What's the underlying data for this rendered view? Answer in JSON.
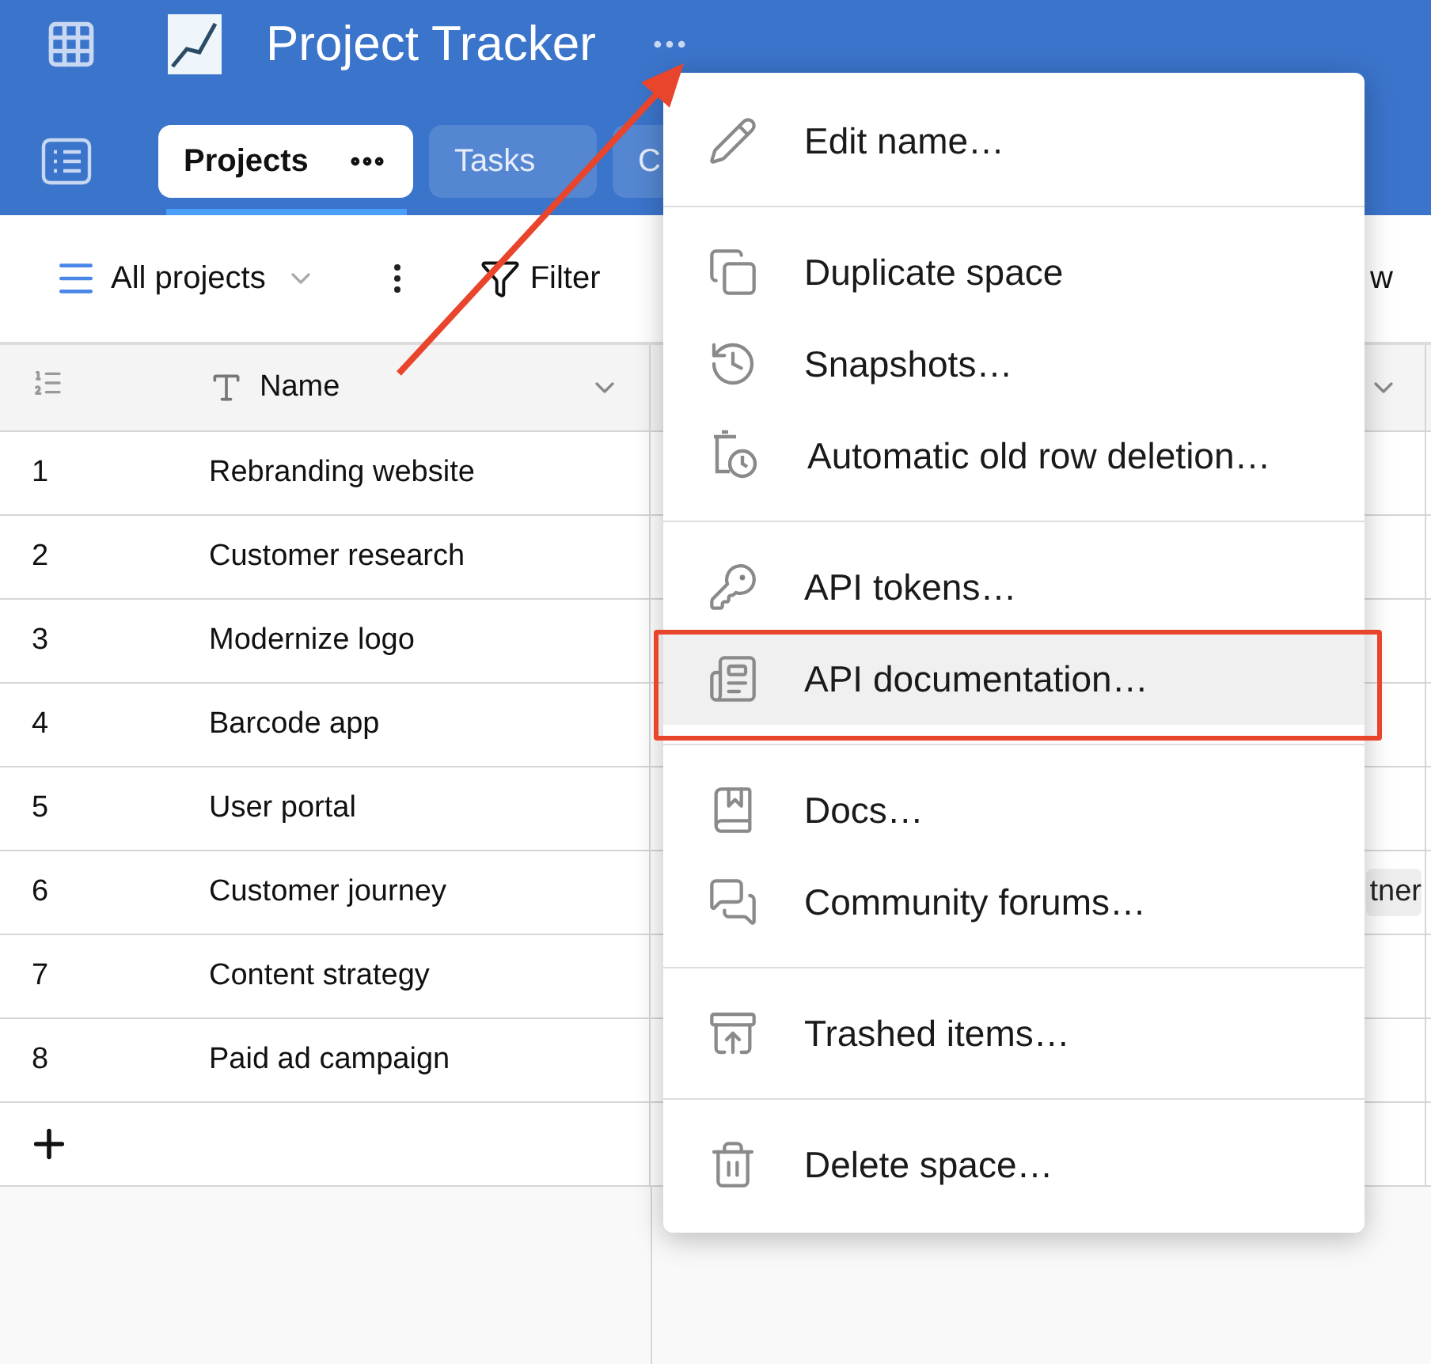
{
  "header": {
    "title": "Project Tracker"
  },
  "tabs": [
    {
      "label": "Projects",
      "selected": true
    },
    {
      "label": "Tasks",
      "selected": false
    },
    {
      "label": "C",
      "selected": false
    }
  ],
  "toolbar": {
    "view": "All projects",
    "filter": "Filter",
    "cut_text": "w"
  },
  "table": {
    "columns": [
      {
        "label": "Name"
      }
    ],
    "rows": [
      {
        "number": "1",
        "name": "Rebranding website"
      },
      {
        "number": "2",
        "name": "Customer research"
      },
      {
        "number": "3",
        "name": "Modernize logo"
      },
      {
        "number": "4",
        "name": "Barcode app"
      },
      {
        "number": "5",
        "name": "User portal"
      },
      {
        "number": "6",
        "name": "Customer journey",
        "column_2": "tner"
      },
      {
        "number": "7",
        "name": "Content strategy"
      },
      {
        "number": "8",
        "name": "Paid ad campaign"
      }
    ]
  },
  "menu": {
    "groups": [
      [
        {
          "kind": "edit",
          "label": "Edit name…",
          "highlighted": false
        }
      ],
      [
        {
          "kind": "duplicate",
          "label": "Duplicate space",
          "highlighted": false
        },
        {
          "kind": "snapshots",
          "label": "Snapshots…",
          "highlighted": false
        },
        {
          "kind": "autodelete",
          "label": "Automatic old row deletion…",
          "highlighted": false
        }
      ],
      [
        {
          "kind": "token",
          "label": "API tokens…",
          "highlighted": false
        },
        {
          "kind": "apidocs",
          "label": "API documentation…",
          "highlighted": true
        }
      ],
      [
        {
          "kind": "docs",
          "label": "Docs…",
          "highlighted": false
        },
        {
          "kind": "forum",
          "label": "Community forums…",
          "highlighted": false
        }
      ],
      [
        {
          "kind": "trashed",
          "label": "Trashed items…",
          "highlighted": false
        }
      ],
      [
        {
          "kind": "delete",
          "label": "Delete space…",
          "highlighted": false
        }
      ]
    ]
  }
}
